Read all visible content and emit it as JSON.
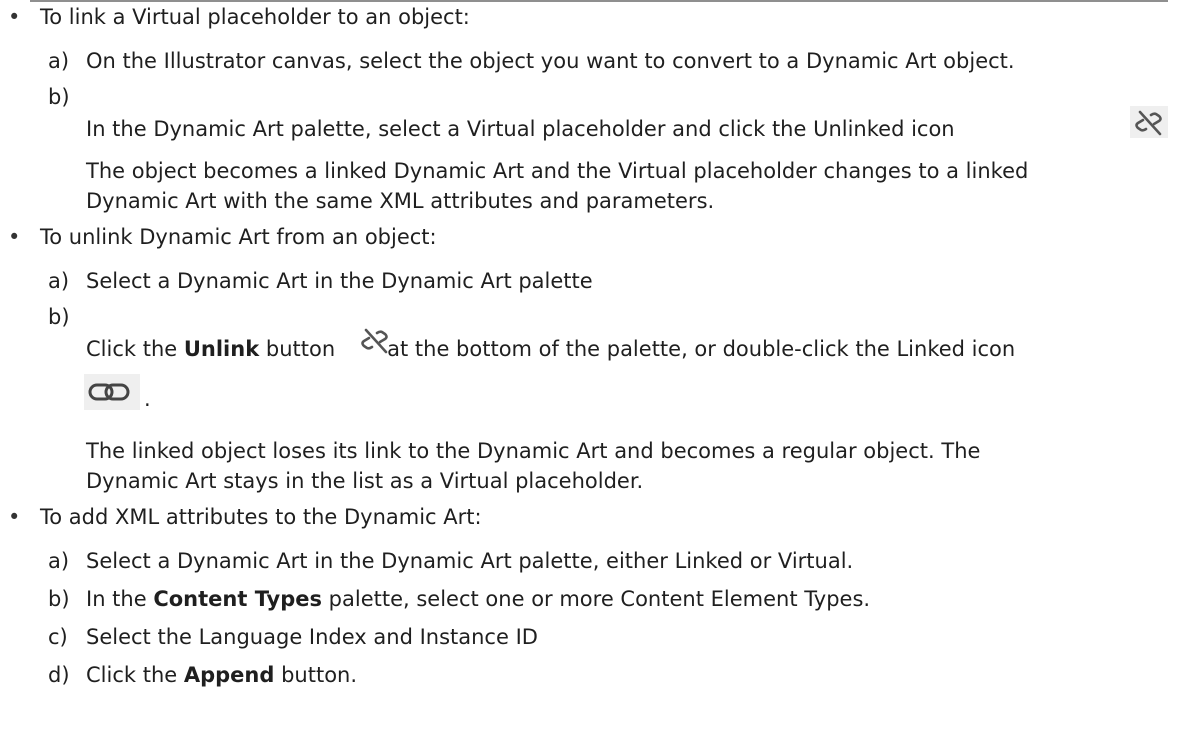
{
  "bullet_glyph": "•",
  "sections": [
    {
      "heading": "To link a Virtual placeholder to an object:",
      "steps": {
        "a": {
          "label": "a)",
          "text": "On the Illustrator canvas, select the object you want to convert to a Dynamic Art object."
        },
        "b": {
          "label": "b)",
          "text": "In the Dynamic Art palette, select a Virtual placeholder and click the Unlinked icon"
        }
      },
      "para_line1": "The object becomes a linked Dynamic Art and the Virtual placeholder changes to a linked",
      "para_line2": "Dynamic Art with the same XML attributes and parameters."
    },
    {
      "heading": "To unlink Dynamic Art from an object:",
      "steps": {
        "a": {
          "label": "a)",
          "text": "Select a Dynamic Art in the Dynamic Art palette"
        },
        "b": {
          "label": "b)",
          "text_before": "Click the ",
          "bold": "Unlink",
          "text_mid": " button",
          "text_after": "at the bottom of the palette, or double-click the Linked icon",
          "trailing": "."
        }
      },
      "para_line1": "The linked object loses its link to the Dynamic Art and becomes a regular object. The",
      "para_line2": "Dynamic Art stays in the list as a Virtual placeholder."
    },
    {
      "heading": "To add XML attributes to the Dynamic Art:",
      "steps": {
        "a": {
          "label": "a)",
          "text": "Select a Dynamic Art in the Dynamic Art palette, either Linked or Virtual."
        },
        "b": {
          "label": "b)",
          "text_before": "In the ",
          "bold": "Content Types",
          "text_after": " palette, select one or more Content Element Types."
        },
        "c": {
          "label": "c)",
          "text": "Select the Language Index and Instance ID"
        },
        "d": {
          "label": "d)",
          "text_before": "Click the ",
          "bold": "Append",
          "text_after": " button."
        }
      }
    }
  ],
  "icons": {
    "unlinked": "unlinked-chain-icon",
    "unlink": "unlink-chain-icon",
    "linked": "linked-chain-icon"
  }
}
